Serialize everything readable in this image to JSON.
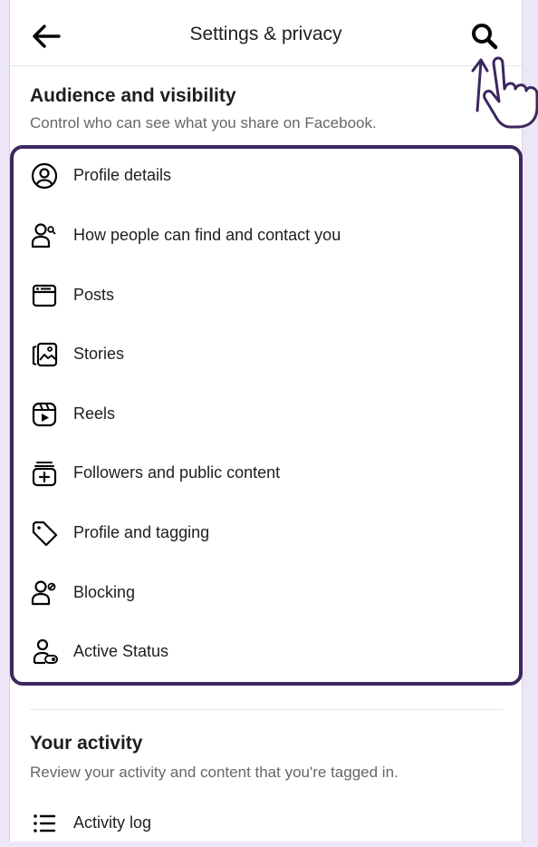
{
  "header": {
    "title": "Settings & privacy",
    "back_icon": "arrow-left-icon",
    "search_icon": "search-icon"
  },
  "audience": {
    "title": "Audience and visibility",
    "subtitle": "Control who can see what you share on Facebook.",
    "items": [
      {
        "label": "Profile details",
        "icon": "profile-circle-icon"
      },
      {
        "label": "How people can find and contact you",
        "icon": "person-search-icon"
      },
      {
        "label": "Posts",
        "icon": "posts-icon"
      },
      {
        "label": "Stories",
        "icon": "stories-icon"
      },
      {
        "label": "Reels",
        "icon": "reels-icon"
      },
      {
        "label": "Followers and public content",
        "icon": "followers-icon"
      },
      {
        "label": "Profile and tagging",
        "icon": "tag-icon"
      },
      {
        "label": "Blocking",
        "icon": "block-person-icon"
      },
      {
        "label": "Active Status",
        "icon": "active-status-icon"
      }
    ]
  },
  "activity": {
    "title": "Your activity",
    "subtitle": "Review your activity and content that you're tagged in.",
    "items": [
      {
        "label": "Activity log",
        "icon": "list-icon"
      }
    ]
  },
  "colors": {
    "highlight": "#3C2760",
    "background": "#ECE6F6"
  }
}
